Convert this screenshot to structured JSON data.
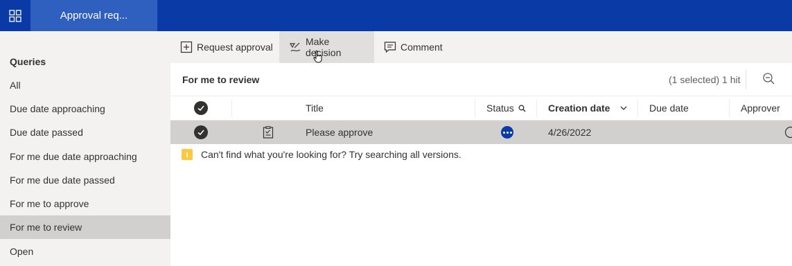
{
  "header": {
    "app_launcher_icon": "grid-icon",
    "active_tab": "Approval req..."
  },
  "sidebar": {
    "heading": "Queries",
    "items": [
      {
        "label": "All"
      },
      {
        "label": "Due date approaching"
      },
      {
        "label": "Due date passed"
      },
      {
        "label": "For me due date approaching"
      },
      {
        "label": "For me due date passed"
      },
      {
        "label": "For me to approve"
      },
      {
        "label": "For me to review",
        "selected": true
      },
      {
        "label": "Open"
      }
    ]
  },
  "toolbar": {
    "request_approval": "Request approval",
    "make_decision": "Make decision",
    "comment": "Comment"
  },
  "view": {
    "title": "For me to review",
    "hits": "(1 selected) 1 hit"
  },
  "table": {
    "columns": {
      "title": "Title",
      "status": "Status",
      "creation_date": "Creation date",
      "due_date": "Due date",
      "approver": "Approver"
    },
    "rows": [
      {
        "title": "Please approve",
        "status": "in-progress",
        "creation_date": "4/26/2022",
        "due_date": "",
        "selected": true
      }
    ]
  },
  "notice": {
    "text": "Can't find what you're looking for? Try searching all versions."
  },
  "colors": {
    "topbar": "#0a3aa6",
    "active_tab": "#2f5fbf",
    "status_accent": "#0a3aa6",
    "warning": "#ffc83d"
  }
}
